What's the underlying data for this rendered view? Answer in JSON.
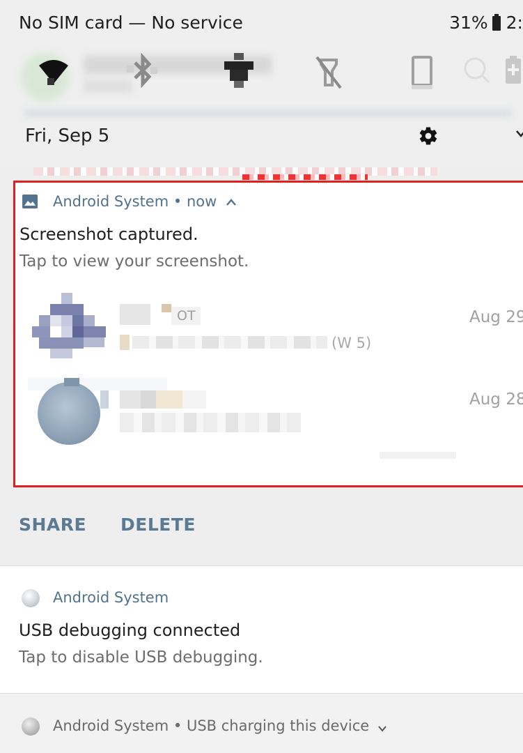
{
  "status_bar": {
    "left_text": "No SIM card — No service",
    "battery_percent": "31%",
    "clock": "2:"
  },
  "quick_settings": {
    "date": "Fri, Sep 5",
    "icons": [
      "wifi-icon",
      "bluetooth-icon",
      "dnd-icon",
      "flashlight-icon",
      "auto-rotate-icon",
      "search-icon",
      "battery-saver-icon"
    ]
  },
  "screenshot_notification": {
    "app_name": "Android System",
    "separator": "•",
    "time": "now",
    "title": "Screenshot captured.",
    "text": "Tap to view your screenshot.",
    "preview_rows": [
      {
        "tag": "OT",
        "snippet": "(W 5)",
        "date": "Aug 29"
      },
      {
        "date": "Aug 28"
      }
    ],
    "actions": {
      "share": "SHARE",
      "delete": "DELETE"
    },
    "highlight_color": "#e02020"
  },
  "usb_debugging_notification": {
    "app_name": "Android System",
    "title": "USB debugging connected",
    "text": "Tap to disable USB debugging."
  },
  "usb_charging_notification": {
    "app_name": "Android System",
    "separator": "•",
    "summary": "USB charging this device"
  },
  "colors": {
    "accent": "#52738f",
    "highlight": "#e02020",
    "panel": "#eeeeee"
  }
}
